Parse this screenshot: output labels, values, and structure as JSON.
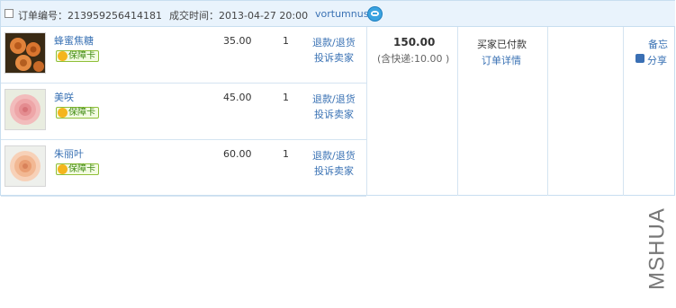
{
  "header": {
    "order_no_label": "订单编号：213959256414181",
    "deal_time_label": "成交时间：2013-04-27 20:00",
    "seller": "vortumnus"
  },
  "items": [
    {
      "name": "蜂蜜焦糖",
      "badge": "保障卡",
      "price": "35.00",
      "qty": "1",
      "action_refund": "退款/退货",
      "action_complain": "投诉卖家"
    },
    {
      "name": "美咲",
      "badge": "保障卡",
      "price": "45.00",
      "qty": "1",
      "action_refund": "退款/退货",
      "action_complain": "投诉卖家"
    },
    {
      "name": "朱丽叶",
      "badge": "保障卡",
      "price": "60.00",
      "qty": "1",
      "action_refund": "退款/退货",
      "action_complain": "投诉卖家"
    }
  ],
  "summary": {
    "total": "150.00",
    "shipping": "(含快递:10.00 )",
    "status": "买家已付款",
    "detail_link": "订单详情",
    "memo": "备忘",
    "share": "分享"
  },
  "watermark": "MSHUA",
  "colors": {
    "link": "#3a72b4",
    "header_bg": "#e9f3fc",
    "border": "#c8def0",
    "badge_green": "#8fbf38"
  },
  "icons": [
    "checkbox-icon",
    "wangwang-icon",
    "guarantee-icon",
    "share-icon"
  ]
}
